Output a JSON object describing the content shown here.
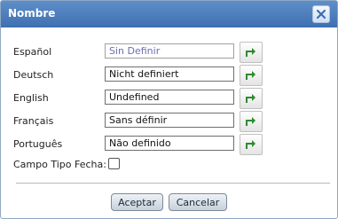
{
  "dialog": {
    "title": "Nombre",
    "close_icon": "close-icon"
  },
  "fields": [
    {
      "label": "Español",
      "value": "Sin Definir"
    },
    {
      "label": "Deutsch",
      "value": "Nicht definiert"
    },
    {
      "label": "English",
      "value": "Undefined"
    },
    {
      "label": "Français",
      "value": "Sans définir"
    },
    {
      "label": "Português",
      "value": "Não definido"
    }
  ],
  "translate_icon": "translate-arrow-icon",
  "date_field": {
    "label": "Campo Tipo Fecha:",
    "checked": false
  },
  "buttons": {
    "accept": "Aceptar",
    "cancel": "Cancelar"
  },
  "colors": {
    "titlebar": "#4a7cbd",
    "accent_icon": "#2e8b2e"
  }
}
